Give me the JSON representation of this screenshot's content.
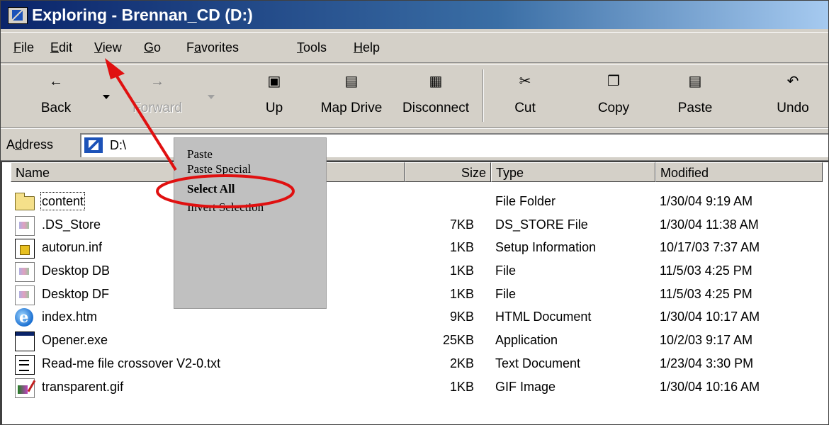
{
  "window": {
    "title": "Exploring - Brennan_CD (D:)"
  },
  "menubar": {
    "items": [
      {
        "pre": "",
        "mnem": "F",
        "post": "ile"
      },
      {
        "pre": "",
        "mnem": "E",
        "post": "dit"
      },
      {
        "pre": "",
        "mnem": "V",
        "post": "iew"
      },
      {
        "pre": "",
        "mnem": "G",
        "post": "o"
      },
      {
        "pre": "F",
        "mnem": "a",
        "post": "vorites"
      },
      {
        "pre": "",
        "mnem": "T",
        "post": "ools"
      },
      {
        "pre": "",
        "mnem": "H",
        "post": "elp"
      }
    ]
  },
  "toolbar": {
    "back": {
      "label": "Back",
      "icon": "←"
    },
    "forward": {
      "label": "Forward",
      "icon": "→"
    },
    "up": {
      "label": "Up",
      "icon": "▣"
    },
    "map_drive": {
      "label": "Map Drive",
      "icon": "▤"
    },
    "disconnect": {
      "label": "Disconnect",
      "icon": "▦"
    },
    "cut": {
      "label": "Cut",
      "icon": "✂"
    },
    "copy": {
      "label": "Copy",
      "icon": "❐"
    },
    "paste": {
      "label": "Paste",
      "icon": "▤"
    },
    "undo": {
      "label": "Undo",
      "icon": "↶"
    }
  },
  "address": {
    "label_pre": "A",
    "label_mnem": "d",
    "label_post": "dress",
    "value": "D:\\"
  },
  "columns": {
    "name": "Name",
    "size": "Size",
    "type": "Type",
    "modified": "Modified"
  },
  "files": [
    {
      "name": "content",
      "size": "",
      "type": "File Folder",
      "modified": "1/30/04 9:19 AM",
      "icon": "folder-icon"
    },
    {
      "name": ".DS_Store",
      "size": "7KB",
      "type": "DS_STORE File",
      "modified": "1/30/04 11:38 AM",
      "icon": "generic-file-icon"
    },
    {
      "name": "autorun.inf",
      "size": "1KB",
      "type": "Setup Information",
      "modified": "10/17/03 7:37 AM",
      "icon": "setup-info-icon"
    },
    {
      "name": "Desktop DB",
      "size": "1KB",
      "type": "File",
      "modified": "11/5/03 4:25 PM",
      "icon": "generic-file-icon"
    },
    {
      "name": "Desktop DF",
      "size": "1KB",
      "type": "File",
      "modified": "11/5/03 4:25 PM",
      "icon": "generic-file-icon"
    },
    {
      "name": "index.htm",
      "size": "9KB",
      "type": "HTML Document",
      "modified": "1/30/04 10:17 AM",
      "icon": "internet-explorer-icon"
    },
    {
      "name": "Opener.exe",
      "size": "25KB",
      "type": "Application",
      "modified": "10/2/03 9:17 AM",
      "icon": "application-icon"
    },
    {
      "name": "Read-me file crossover V2-0.txt",
      "size": "2KB",
      "type": "Text Document",
      "modified": "1/23/04 3:30 PM",
      "icon": "text-document-icon"
    },
    {
      "name": "transparent.gif",
      "size": "1KB",
      "type": "GIF Image",
      "modified": "1/30/04 10:16 AM",
      "icon": "gif-image-icon"
    }
  ],
  "overlay_menu": {
    "items": [
      "Paste",
      "Paste Special",
      "Select All",
      "Invert Selection"
    ],
    "highlighted": "Select All"
  },
  "annotation": {
    "arrow_color": "#e01010",
    "ellipse_color": "#e01010"
  }
}
